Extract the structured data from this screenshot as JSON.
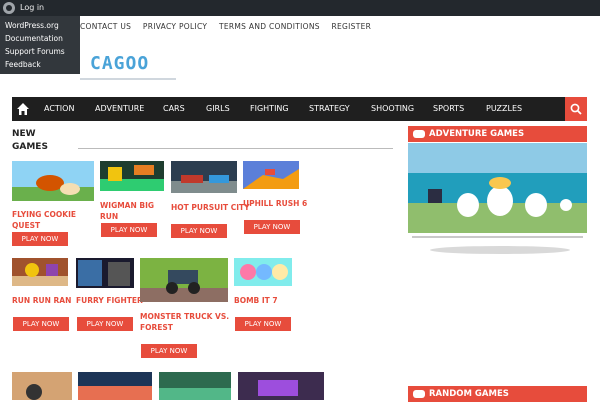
{
  "adminbar": {
    "login": "Log in"
  },
  "wp_menu": [
    "WordPress.org",
    "Documentation",
    "Support Forums",
    "Feedback"
  ],
  "topnav": [
    "CONTACT US",
    "PRIVACY POLICY",
    "TERMS AND CONDITIONS",
    "REGISTER"
  ],
  "logo": {
    "text": "CAGOO"
  },
  "mainnav": [
    "ACTION",
    "ADVENTURE",
    "CARS",
    "GIRLS",
    "FIGHTING",
    "STRATEGY",
    "SHOOTING",
    "SPORTS",
    "PUZZLES"
  ],
  "section": {
    "title": "NEW GAMES"
  },
  "play_label": "PLAY NOW",
  "games": [
    {
      "title": "FLYING COOKIE QUEST"
    },
    {
      "title": "WIGMAN BIG RUN"
    },
    {
      "title": "HOT PURSUIT CITY"
    },
    {
      "title": "UPHILL RUSH 6"
    },
    {
      "title": "RUN RUN RAN"
    },
    {
      "title": "FURRY FIGHTER"
    },
    {
      "title": "MONSTER TRUCK VS. FOREST"
    },
    {
      "title": "BOMB IT 7"
    }
  ],
  "widgets": {
    "adventure": "ADVENTURE GAMES",
    "random": "RANDOM GAMES"
  },
  "colors": {
    "accent": "#e74c3c",
    "nav_bg": "#1f1f1f",
    "adminbar_bg": "#23282d"
  }
}
